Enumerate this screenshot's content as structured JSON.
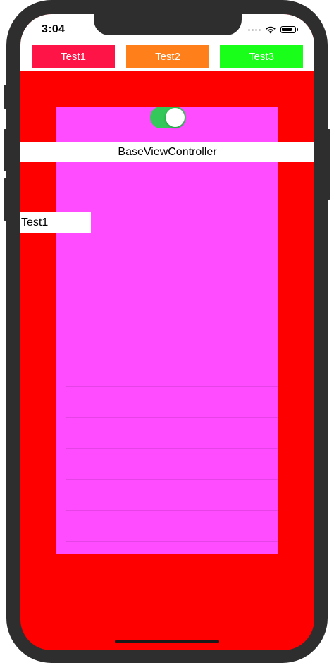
{
  "status_bar": {
    "time": "3:04",
    "icons": [
      "cellular-dots-icon",
      "wifi-icon",
      "battery-icon"
    ],
    "battery_level": 0.85
  },
  "tabs": [
    {
      "label": "Test1",
      "color": "#ff1447"
    },
    {
      "label": "Test2",
      "color": "#ff801a"
    },
    {
      "label": "Test3",
      "color": "#1aff1a"
    }
  ],
  "colors": {
    "background": "#ff0000",
    "content_area": "#ff4cff",
    "toggle_on": "#34c759"
  },
  "toggle": {
    "state": "on"
  },
  "title_bar": {
    "text": "BaseViewController"
  },
  "side_label": {
    "text": "Test1"
  }
}
